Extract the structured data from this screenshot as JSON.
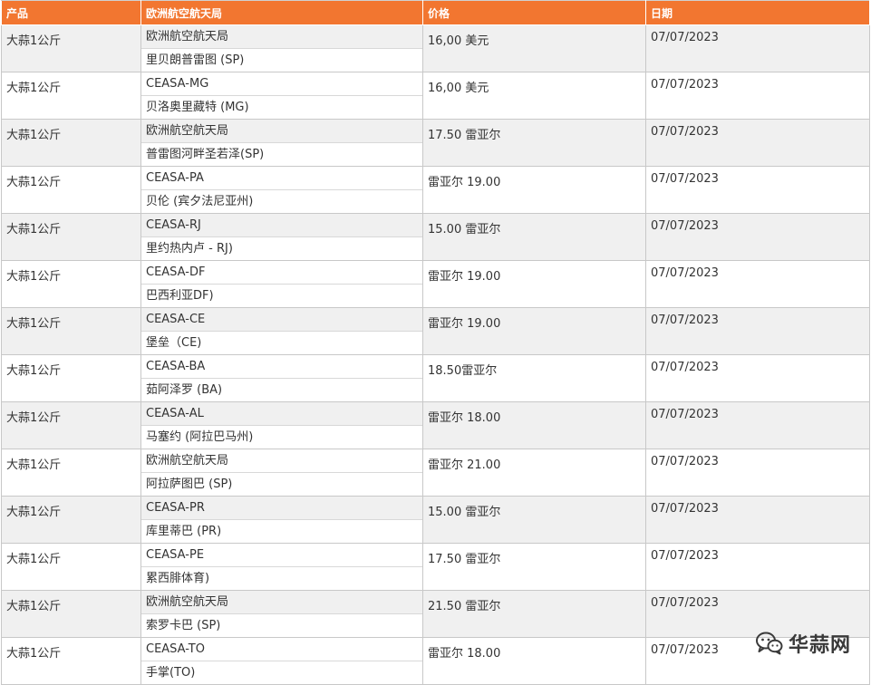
{
  "table": {
    "headers": {
      "product": "产品",
      "market": "欧洲航空航天局",
      "price": "价格",
      "date": "日期"
    },
    "rows": [
      {
        "product": "大蒜1公斤",
        "market": "欧洲航空航天局",
        "location": "里贝朗普雷图 (SP)",
        "price": "16,00 美元",
        "date": "07/07/2023"
      },
      {
        "product": "大蒜1公斤",
        "market": "CEASA-MG",
        "location": "贝洛奥里藏特 (MG)",
        "price": "16,00 美元",
        "date": "07/07/2023"
      },
      {
        "product": "大蒜1公斤",
        "market": "欧洲航空航天局",
        "location": "普雷图河畔圣若泽(SP)",
        "price": "17.50 雷亚尔",
        "date": "07/07/2023"
      },
      {
        "product": "大蒜1公斤",
        "market": "CEASA-PA",
        "location": "贝伦 (宾夕法尼亚州)",
        "price": "雷亚尔 19.00",
        "date": "07/07/2023"
      },
      {
        "product": "大蒜1公斤",
        "market": "CEASA-RJ",
        "location": "里约热内卢 - RJ)",
        "price": "15.00 雷亚尔",
        "date": "07/07/2023"
      },
      {
        "product": "大蒜1公斤",
        "market": "CEASA-DF",
        "location": "巴西利亚DF)",
        "price": "雷亚尔 19.00",
        "date": "07/07/2023"
      },
      {
        "product": "大蒜1公斤",
        "market": "CEASA-CE",
        "location": "堡垒（CE)",
        "price": "雷亚尔 19.00",
        "date": "07/07/2023"
      },
      {
        "product": "大蒜1公斤",
        "market": "CEASA-BA",
        "location": "茹阿泽罗 (BA)",
        "price": "18.50雷亚尔",
        "date": "07/07/2023"
      },
      {
        "product": "大蒜1公斤",
        "market": "CEASA-AL",
        "location": "马塞约 (阿拉巴马州)",
        "price": "雷亚尔 18.00",
        "date": "07/07/2023"
      },
      {
        "product": "大蒜1公斤",
        "market": "欧洲航空航天局",
        "location": "阿拉萨图巴 (SP)",
        "price": "雷亚尔 21.00",
        "date": "07/07/2023"
      },
      {
        "product": "大蒜1公斤",
        "market": "CEASA-PR",
        "location": "库里蒂巴 (PR)",
        "price": "15.00 雷亚尔",
        "date": "07/07/2023"
      },
      {
        "product": "大蒜1公斤",
        "market": "CEASA-PE",
        "location": "累西腓体育)",
        "price": "17.50 雷亚尔",
        "date": "07/07/2023"
      },
      {
        "product": "大蒜1公斤",
        "market": "欧洲航空航天局",
        "location": "索罗卡巴 (SP)",
        "price": "21.50 雷亚尔",
        "date": "07/07/2023"
      },
      {
        "product": "大蒜1公斤",
        "market": "CEASA-TO",
        "location": "手掌(TO)",
        "price": "雷亚尔 18.00",
        "date": "07/07/2023"
      }
    ]
  },
  "watermark": {
    "text": "华蒜网",
    "icon": "wechat-icon"
  },
  "colors": {
    "header_background": "#f27630",
    "header_text": "#ffffff",
    "row_alt_background": "#f0f0f0"
  }
}
